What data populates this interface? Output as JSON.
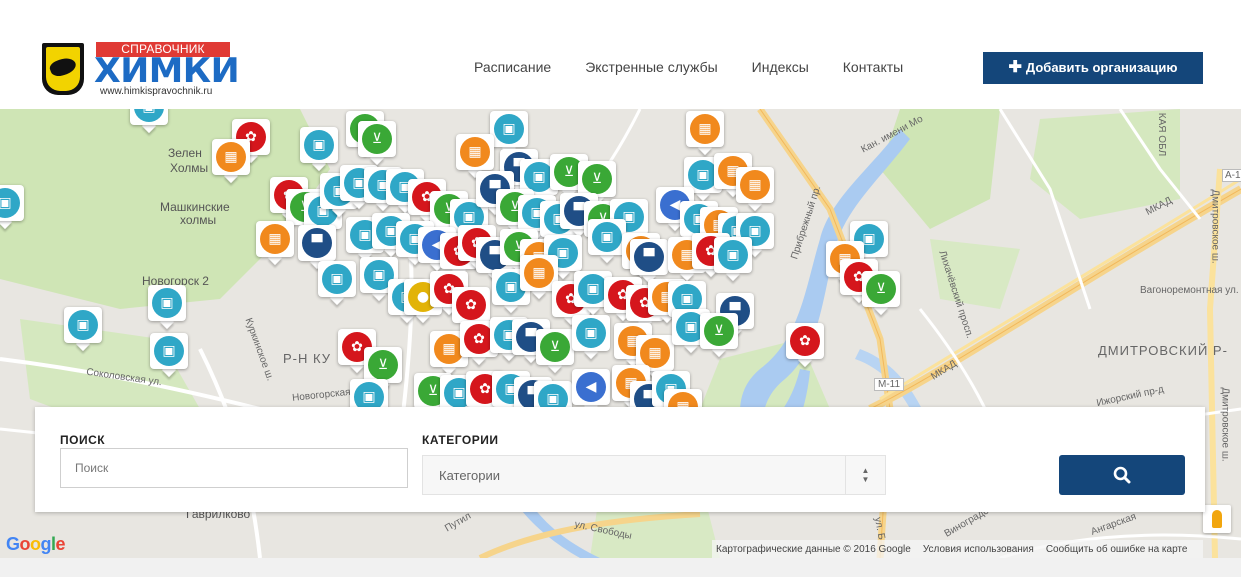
{
  "header": {
    "logo_tag": "СПРАВОЧНИК ГОРОДА",
    "logo_main": "ХИМКИ",
    "logo_url": "www.himkispravochnik.ru",
    "nav": [
      "Расписание",
      "Экстренные службы",
      "Индексы",
      "Контакты"
    ],
    "add_button": "Добавить организацию"
  },
  "map": {
    "labels": {
      "zelen": "Зелен",
      "holmy": "Холмы",
      "mashkinskie": "Машкинские",
      "holmy2": "холмы",
      "novogorsk": "Новогорск 2",
      "district_ku": "Р-Н КУ",
      "sokolovskaya": "Соколовская ул.",
      "novogorskaya": "Новогорская ул.",
      "kurkinskoe": "Куркинское ш.",
      "kanal": "Кан. имени Мо",
      "pribrezhny": "Прибрежный пр.",
      "lihachevsky": "Лихачёвский просп.",
      "mkad1": "МКАД",
      "mkad2": "МКАД",
      "vagonoremontnaya": "Вагоноремонтная ул.",
      "dmitrovsky": "ДМИТРОВСКИЙ Р-",
      "dmitrovskoe": "Дмитровское ш.",
      "izhorsky": "Ижорский пр-д",
      "dmitrovskoe2": "Дмитровское ш.",
      "m11": "М-11",
      "a1": "А-1",
      "kaya_obl": "КАЯ ОБЛ",
      "gavrilkovo": "Гаврилково",
      "putilkovo": "Путил",
      "svobody": "ул. Свободы",
      "ul_b": "ул. Б",
      "angarskaya": "Ангарская",
      "vinogradovo": "Виноградо"
    },
    "attribution": [
      "Картографические данные © 2016 Google",
      "Условия использования",
      "Сообщить об ошибке на карте"
    ],
    "google_logo": "Google",
    "pin_colors": {
      "teal": "#2fa7c7",
      "orange": "#f1891d",
      "red": "#d5161c",
      "green": "#3aa836",
      "navy": "#1f4e86",
      "blue": "#3a6fd0",
      "yellow": "#e2b308"
    },
    "pin_icons": {
      "teal": "briefcase-icon",
      "orange": "building-icon",
      "red": "paw-icon",
      "green": "cart-icon",
      "navy": "taxi-icon",
      "blue": "megaphone-icon",
      "yellow": "coin-icon"
    }
  },
  "search": {
    "search_label": "ПОИСК",
    "search_placeholder": "Поиск",
    "category_label": "КАТЕГОРИИ",
    "category_value": "Категории",
    "button_icon": "search-icon"
  }
}
